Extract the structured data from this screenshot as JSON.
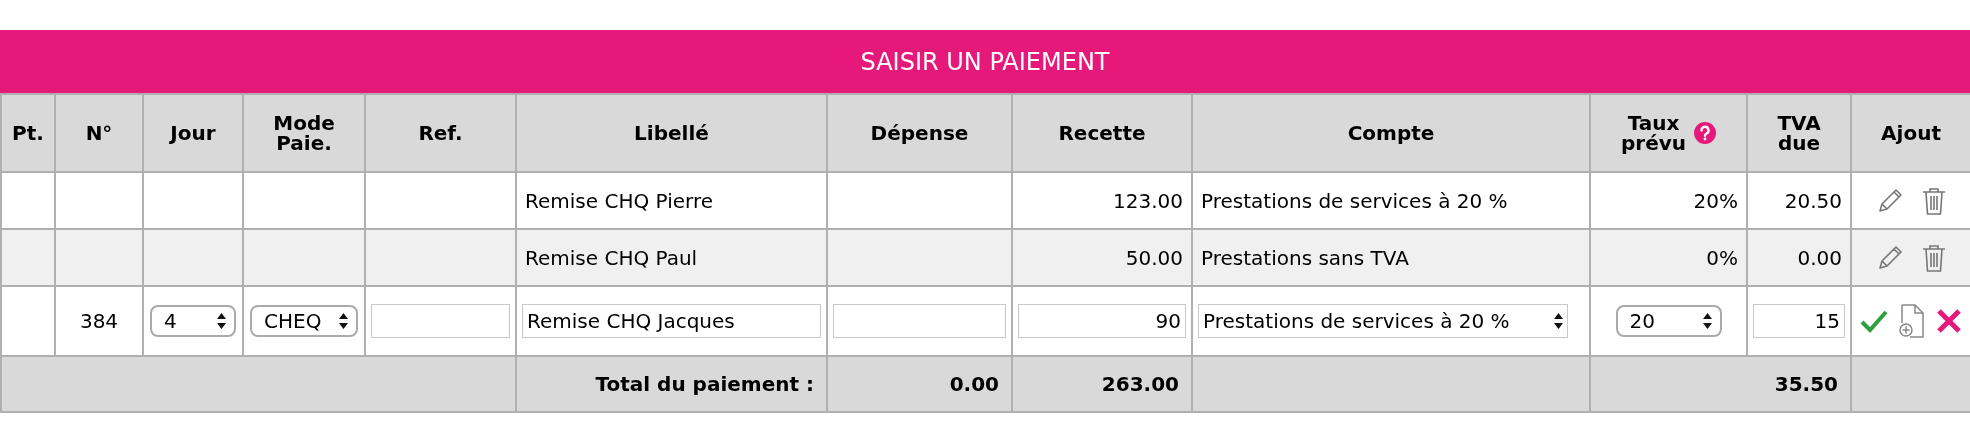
{
  "title": "SAISIR UN PAIEMENT",
  "columns": [
    {
      "label": "Pt."
    },
    {
      "label": "N°"
    },
    {
      "label": "Jour"
    },
    {
      "label": "Mode\nPaie."
    },
    {
      "label": "Ref."
    },
    {
      "label": "Libellé"
    },
    {
      "label": "Dépense"
    },
    {
      "label": "Recette"
    },
    {
      "label": "Compte"
    },
    {
      "label": "Taux\nprévu",
      "help": true
    },
    {
      "label": "TVA\ndue"
    },
    {
      "label": "Ajout"
    }
  ],
  "rows": [
    {
      "kind": "display",
      "libelle": "Remise CHQ Pierre",
      "recette": "123.00",
      "compte": "Prestations de services à 20 %",
      "taux": "20%",
      "tva": "20.50"
    },
    {
      "kind": "display",
      "libelle": "Remise CHQ Paul",
      "recette": "50.00",
      "compte": "Prestations sans TVA",
      "taux": "0%",
      "tva": "0.00"
    },
    {
      "kind": "edit",
      "numero": "384",
      "jour": "4",
      "mode": "CHEQ",
      "libelle": "Remise CHQ Jacques",
      "recette": "90",
      "compte": "Prestations de services à 20 %",
      "taux": "20",
      "tva": "15"
    }
  ],
  "total": {
    "label": "Total du paiement :",
    "depense": "0.00",
    "recette": "263.00",
    "tva": "35.50"
  }
}
